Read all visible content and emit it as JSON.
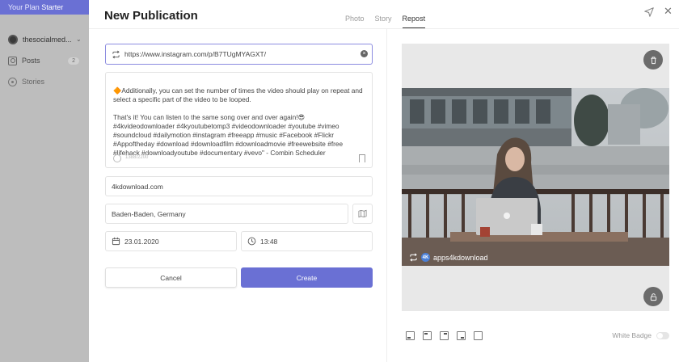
{
  "sidebar": {
    "plan_label": "Your Plan",
    "plan_name": "Starter",
    "account_name": "thesocialmed...",
    "items": [
      {
        "label": "Posts",
        "count": "2"
      },
      {
        "label": "Stories"
      }
    ]
  },
  "header": {
    "title": "New Publication",
    "tabs": [
      "Photo",
      "Story",
      "Repost"
    ],
    "active_tab": "Repost"
  },
  "form": {
    "url": "https://www.instagram.com/p/B7TUgMYAGXT/",
    "caption_p1": "🔶Additionally, you can set the number of times the video should play on repeat and select a specific part of the video to be looped.",
    "caption_p2": "That's it! You can listen to the same song over and over again!😎 #4kvideodownloader #4kyoutubetomp3 #videodownloader #youtube #vimeo #soundcloud #dailymotion #instagram #freeapp #music #Facebook #Flickr #Appoftheday #download #downloadfilm #downloadmovie #freewebsite #free #lifehack #downloadyoutube #documentary #vevo\" - Combin Scheduler",
    "char_count": "1388/2200",
    "site": "4kdownload.com",
    "location": "Baden-Baden, Germany",
    "date": "23.01.2020",
    "time": "13:48",
    "cancel_label": "Cancel",
    "create_label": "Create"
  },
  "preview": {
    "attribution": "apps4kdownload",
    "white_badge_label": "White Badge"
  },
  "colors": {
    "accent": "#6a70d4",
    "sidebar_bg": "#bdbdbd"
  }
}
